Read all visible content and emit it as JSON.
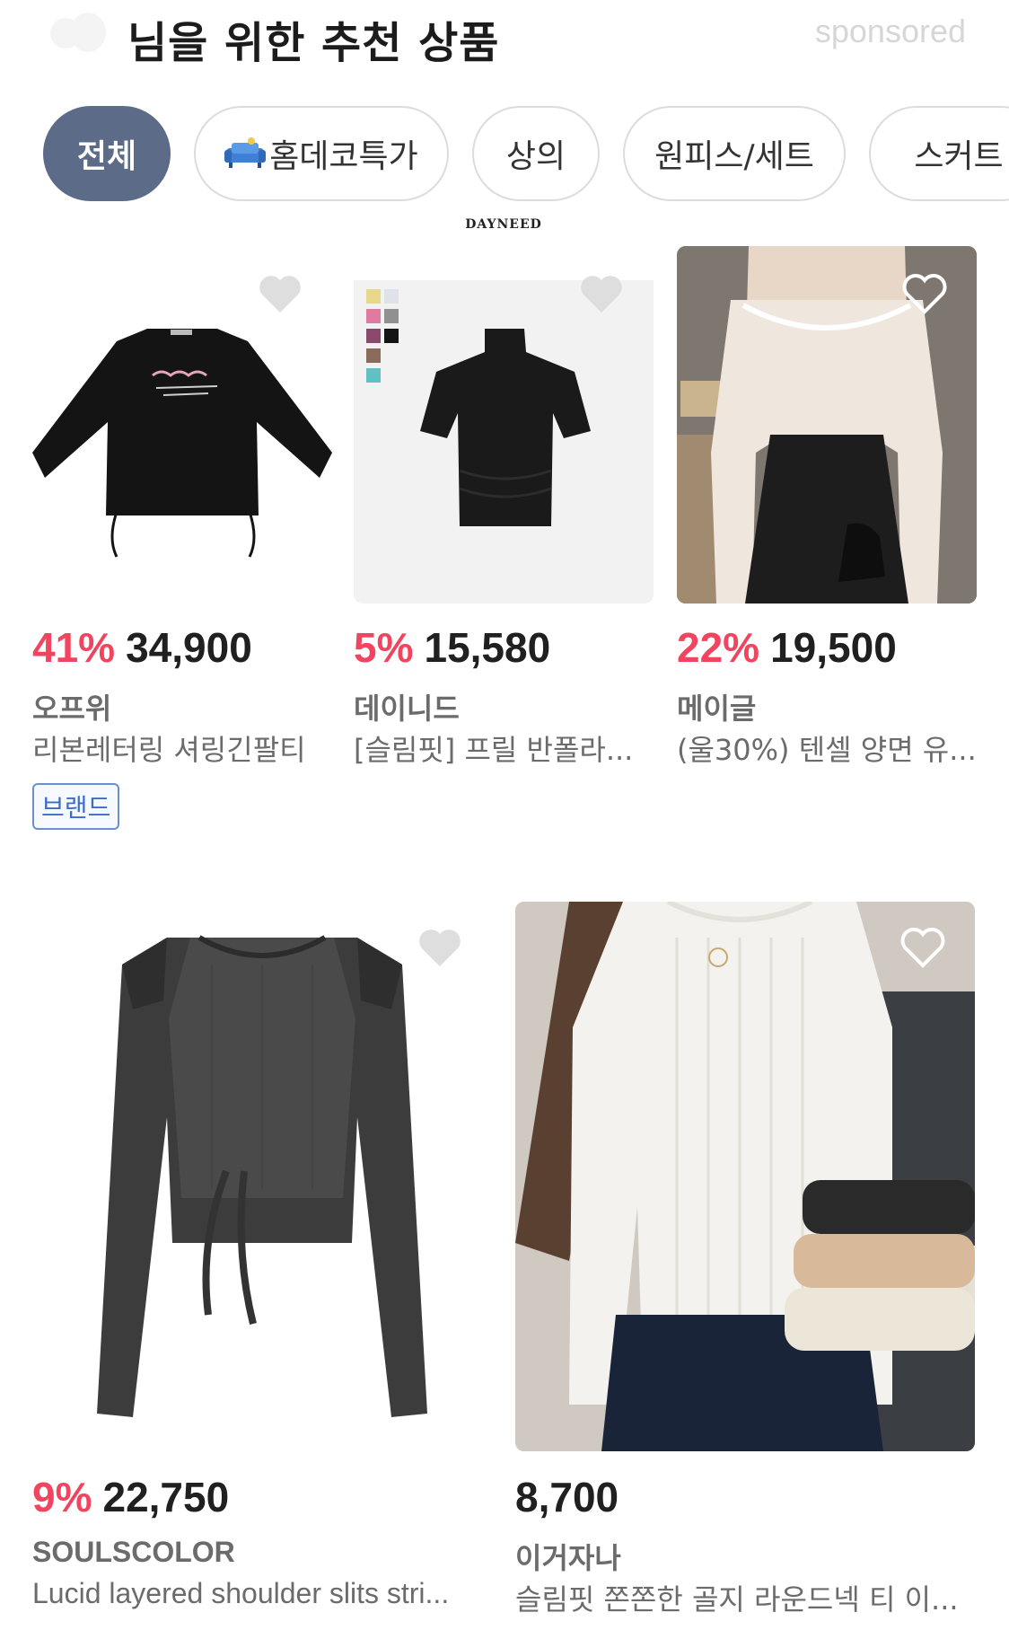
{
  "header": {
    "title": "님을 위한 추천 상품",
    "sponsored": "sponsored"
  },
  "categories": [
    {
      "label": "전체",
      "active": true
    },
    {
      "label": "홈데코특가",
      "icon": "sofa-icon"
    },
    {
      "label": "상의"
    },
    {
      "label": "원피스/세트"
    },
    {
      "label": "스커트"
    }
  ],
  "colors": {
    "accent": "#5b6b88",
    "discount": "#f0445f",
    "badge_border": "#6d8fd0"
  },
  "products": [
    {
      "discount": "41%",
      "price": "34,900",
      "brand": "오프위",
      "name": "리본레터링 셔링긴팔티",
      "badge": "브랜드",
      "image": "black-long-sleeve-tee",
      "liked": false
    },
    {
      "discount": "5%",
      "price": "15,580",
      "brand": "데이니드",
      "name": "[슬림핏] 프릴 반폴라...",
      "image": "black-short-sleeve-turtleneck",
      "image_logo": "DAYNEED",
      "liked": false
    },
    {
      "discount": "22%",
      "price": "19,500",
      "brand": "메이글",
      "name": "(울30%) 텐셀 양면 유...",
      "image": "ivory-scoop-neck-top",
      "liked": false
    },
    {
      "discount": "9%",
      "price": "22,750",
      "brand": "SOULSCOLOR",
      "name": "Lucid layered shoulder slits stri...",
      "image": "grey-layered-ribbed-top",
      "liked": false
    },
    {
      "discount": "",
      "price": "8,700",
      "brand": "이거자나",
      "name": "슬림핏 쫀쫀한 골지 라운드넥 티 이...",
      "image": "white-ribbed-knit",
      "liked": false
    }
  ]
}
